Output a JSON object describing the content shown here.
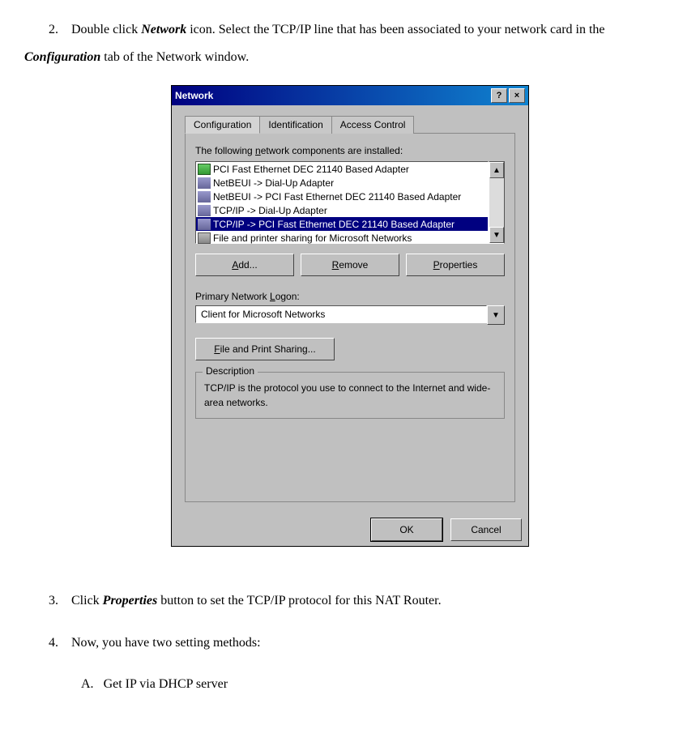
{
  "doc": {
    "item2_num": "2.",
    "item2_a": "Double click ",
    "item2_network": "Network",
    "item2_b": " icon. Select the TCP/IP line that has been associated to your network card in the ",
    "item2_config": "Configuration",
    "item2_c": " tab of the Network window.",
    "item3_num": "3.",
    "item3_a": "Click ",
    "item3_properties": "Properties",
    "item3_b": " button to set the TCP/IP protocol for this NAT Router.",
    "item4_num": "4.",
    "item4_text": "Now, you have two setting methods:",
    "subA_num": "A.",
    "subA_text": "Get IP via DHCP server"
  },
  "win": {
    "title": "Network",
    "help": "?",
    "close": "×",
    "tabs": {
      "config": "Configuration",
      "ident": "Identification",
      "access": "Access Control"
    },
    "components_label_a": "The following ",
    "components_label_u": "n",
    "components_label_b": "etwork components are installed:",
    "rows": [
      "PCI Fast Ethernet DEC 21140 Based Adapter",
      "NetBEUI -> Dial-Up Adapter",
      "NetBEUI -> PCI Fast Ethernet DEC 21140 Based Adapter",
      "TCP/IP -> Dial-Up Adapter",
      "TCP/IP -> PCI Fast Ethernet DEC 21140 Based Adapter",
      "File and printer sharing for Microsoft Networks"
    ],
    "btn_add_u": "A",
    "btn_add": "dd...",
    "btn_remove": "R",
    "btn_remove_b": "emove",
    "btn_properties": "P",
    "btn_properties_b": "roperties",
    "logon_label_a": "Primary Network ",
    "logon_label_u": "L",
    "logon_label_b": "ogon:",
    "logon_value": "Client for Microsoft Networks",
    "file_print_u": "F",
    "file_print": "ile and Print Sharing...",
    "desc_title": "Description",
    "desc_text": "TCP/IP is the protocol you use to connect to the Internet and wide-area networks.",
    "ok": "OK",
    "cancel": "Cancel",
    "up": "▲",
    "down": "▼"
  }
}
